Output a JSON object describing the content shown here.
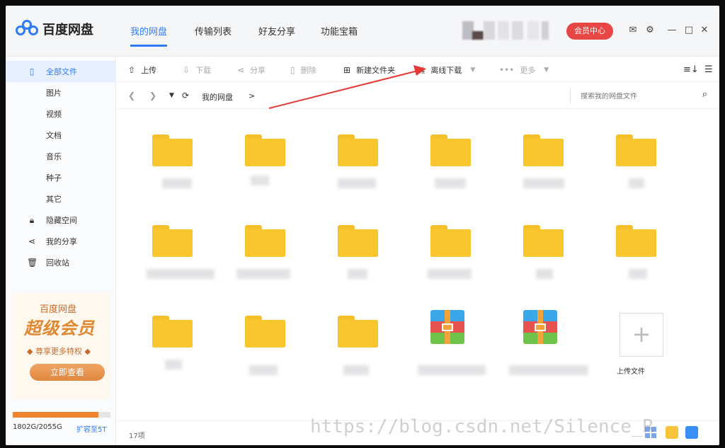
{
  "app": {
    "logo_text": "百度网盘"
  },
  "nav": {
    "tabs": [
      {
        "label": "我的网盘"
      },
      {
        "label": "传输列表"
      },
      {
        "label": "好友分享"
      },
      {
        "label": "功能宝箱"
      }
    ]
  },
  "header": {
    "vip_label": "会员中心"
  },
  "sidebar": {
    "items": [
      {
        "label": "全部文件"
      },
      {
        "label": "图片"
      },
      {
        "label": "视频"
      },
      {
        "label": "文档"
      },
      {
        "label": "音乐"
      },
      {
        "label": "种子"
      },
      {
        "label": "其它"
      },
      {
        "label": "隐藏空间"
      },
      {
        "label": "我的分享"
      },
      {
        "label": "回收站"
      }
    ],
    "promo": {
      "brand": "百度网盘",
      "title": "超级会员",
      "tagline": "◆ 尊享更多特权 ◆",
      "button": "立即查看"
    },
    "storage": {
      "text": "1802G/2055G",
      "expand": "扩容至5T",
      "used_fraction": 0.877
    }
  },
  "toolbar": {
    "upload": "上传",
    "download": "下载",
    "share": "分享",
    "delete": "删除",
    "new_folder": "新建文件夹",
    "offline_download": "离线下载",
    "more": "更多"
  },
  "path": {
    "current": "我的网盘",
    "sep": ">",
    "search_placeholder": "搜索我的网盘文件"
  },
  "grid": {
    "upload_label": "上传文件"
  },
  "status": {
    "count": "17项"
  },
  "watermark": "https://blog.csdn.net/Silence_R",
  "colors": {
    "accent": "#2f7cf6",
    "vip": "#e84545",
    "folder": "#f8c72f",
    "storage": "#f0842e"
  }
}
